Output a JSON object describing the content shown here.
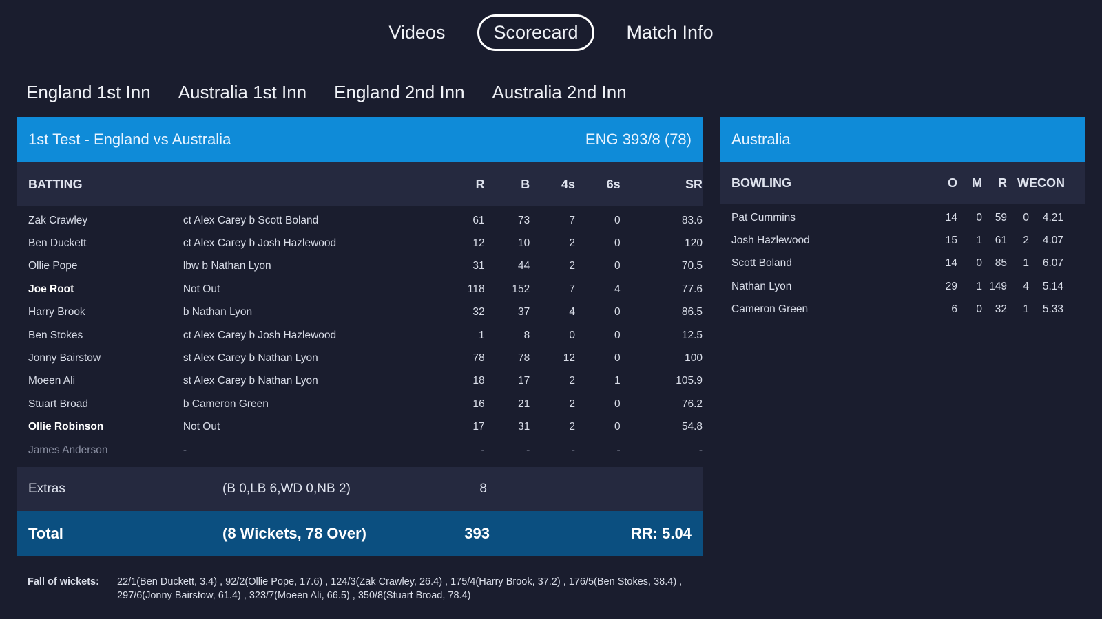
{
  "nav": {
    "tabs": [
      {
        "label": "Videos"
      },
      {
        "label": "Scorecard"
      },
      {
        "label": "Match Info"
      }
    ]
  },
  "innings_tabs": [
    {
      "label": "England 1st Inn"
    },
    {
      "label": "Australia 1st Inn"
    },
    {
      "label": "England 2nd Inn"
    },
    {
      "label": "Australia 2nd Inn"
    }
  ],
  "batting": {
    "match_title": "1st Test - England vs Australia",
    "score_summary": "ENG 393/8 (78)",
    "header": {
      "title": "BATTING",
      "r": "R",
      "b": "B",
      "fours": "4s",
      "sixes": "6s",
      "sr": "SR"
    },
    "rows": [
      {
        "name": "Zak Crawley",
        "dismissal": "ct Alex Carey b Scott Boland",
        "r": "61",
        "b": "73",
        "fours": "7",
        "sixes": "0",
        "sr": "83.6"
      },
      {
        "name": "Ben Duckett",
        "dismissal": "ct Alex Carey b Josh Hazlewood",
        "r": "12",
        "b": "10",
        "fours": "2",
        "sixes": "0",
        "sr": "120"
      },
      {
        "name": "Ollie Pope",
        "dismissal": "lbw b Nathan Lyon",
        "r": "31",
        "b": "44",
        "fours": "2",
        "sixes": "0",
        "sr": "70.5"
      },
      {
        "name": "Joe Root",
        "dismissal": "Not Out",
        "r": "118",
        "b": "152",
        "fours": "7",
        "sixes": "4",
        "sr": "77.6"
      },
      {
        "name": "Harry Brook",
        "dismissal": "b Nathan Lyon",
        "r": "32",
        "b": "37",
        "fours": "4",
        "sixes": "0",
        "sr": "86.5"
      },
      {
        "name": "Ben Stokes",
        "dismissal": "ct Alex Carey b Josh Hazlewood",
        "r": "1",
        "b": "8",
        "fours": "0",
        "sixes": "0",
        "sr": "12.5"
      },
      {
        "name": "Jonny Bairstow",
        "dismissal": "st Alex Carey b Nathan Lyon",
        "r": "78",
        "b": "78",
        "fours": "12",
        "sixes": "0",
        "sr": "100"
      },
      {
        "name": "Moeen Ali",
        "dismissal": "st Alex Carey b Nathan Lyon",
        "r": "18",
        "b": "17",
        "fours": "2",
        "sixes": "1",
        "sr": "105.9"
      },
      {
        "name": "Stuart Broad",
        "dismissal": "b Cameron Green",
        "r": "16",
        "b": "21",
        "fours": "2",
        "sixes": "0",
        "sr": "76.2"
      },
      {
        "name": "Ollie Robinson",
        "dismissal": "Not Out",
        "r": "17",
        "b": "31",
        "fours": "2",
        "sixes": "0",
        "sr": "54.8"
      },
      {
        "name": "James Anderson",
        "dismissal": "-",
        "r": "-",
        "b": "-",
        "fours": "-",
        "sixes": "-",
        "sr": "-"
      }
    ],
    "extras": {
      "label": "Extras",
      "detail": "(B 0,LB 6,WD 0,NB 2)",
      "value": "8"
    },
    "total": {
      "label": "Total",
      "detail": "(8 Wickets, 78 Over)",
      "value": "393",
      "run_rate": "RR: 5.04"
    },
    "fall_of_wickets": {
      "label": "Fall of wickets:",
      "text": "22/1(Ben Duckett, 3.4) , 92/2(Ollie Pope, 17.6) , 124/3(Zak Crawley, 26.4) , 175/4(Harry Brook, 37.2) , 176/5(Ben Stokes, 38.4) , 297/6(Jonny Bairstow, 61.4) , 323/7(Moeen Ali, 66.5) , 350/8(Stuart Broad, 78.4)"
    }
  },
  "bowling": {
    "team": "Australia",
    "header": {
      "title": "BOWLING",
      "o": "O",
      "m": "M",
      "r": "R",
      "w": "W",
      "econ": "ECON"
    },
    "rows": [
      {
        "name": "Pat Cummins",
        "o": "14",
        "m": "0",
        "r": "59",
        "w": "0",
        "econ": "4.21"
      },
      {
        "name": "Josh Hazlewood",
        "o": "15",
        "m": "1",
        "r": "61",
        "w": "2",
        "econ": "4.07"
      },
      {
        "name": "Scott Boland",
        "o": "14",
        "m": "0",
        "r": "85",
        "w": "1",
        "econ": "6.07"
      },
      {
        "name": "Nathan Lyon",
        "o": "29",
        "m": "1",
        "r": "149",
        "w": "4",
        "econ": "5.14"
      },
      {
        "name": "Cameron Green",
        "o": "6",
        "m": "0",
        "r": "32",
        "w": "1",
        "econ": "5.33"
      }
    ]
  },
  "colors": {
    "background": "#1a1d2e",
    "header_blue": "#0f8bd8",
    "total_bar": "#0b4f80",
    "subheader": "#25293f"
  }
}
